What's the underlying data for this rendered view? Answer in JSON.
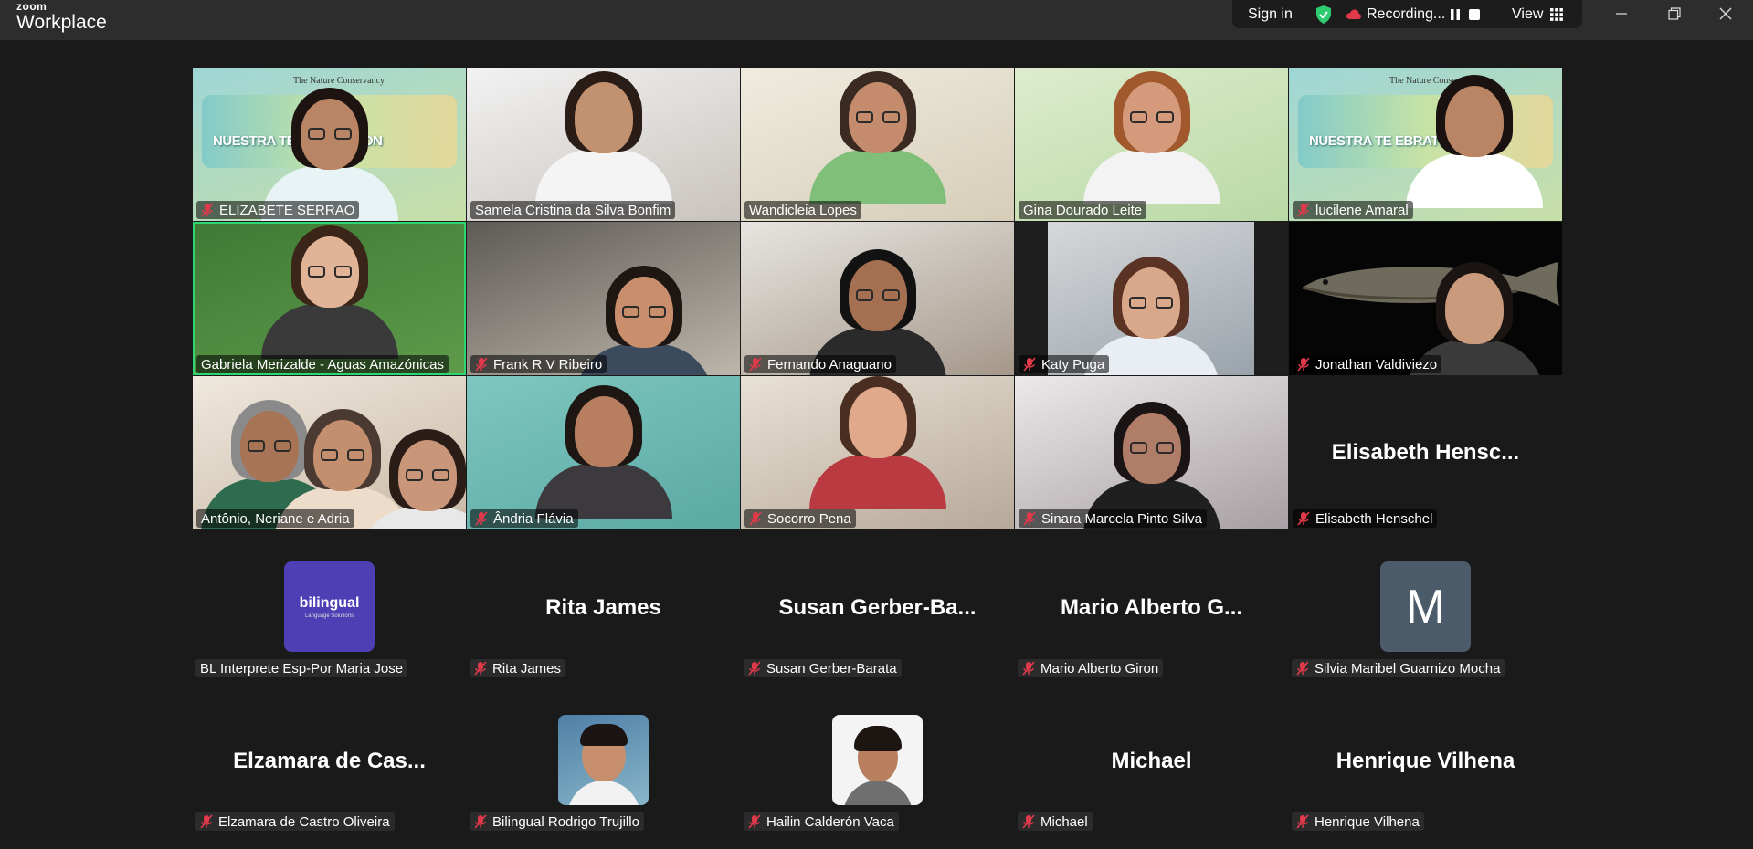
{
  "app": {
    "brand_top": "zoom",
    "brand_main": "Workplace"
  },
  "topbar": {
    "sign_in": "Sign in",
    "recording_label": "Recording...",
    "view_label": "View"
  },
  "participants": [
    {
      "name": "ELIZABETE SERRAO",
      "muted": true,
      "banner": "NUESTRA TE    ELEBRATION",
      "logo": "The Nature Conservancy"
    },
    {
      "name": "Samela Cristina da Silva Bonfim",
      "muted": false
    },
    {
      "name": "Wandicleia Lopes",
      "muted": false
    },
    {
      "name": "Gina Dourado Leite",
      "muted": false
    },
    {
      "name": "lucilene Amaral",
      "muted": true,
      "banner": "NUESTRA TE    EBRATION",
      "logo": "The Nature Conservancy"
    },
    {
      "name": "Gabriela Merizalde - Aguas Amazónicas",
      "muted": false,
      "active": true
    },
    {
      "name": "Frank R V Ribeiro",
      "muted": true
    },
    {
      "name": "Fernando Anaguano",
      "muted": true
    },
    {
      "name": "Katy Puga",
      "muted": true
    },
    {
      "name": "Jonathan Valdiviezo",
      "muted": true
    },
    {
      "name": "Antônio, Neriane e Adria",
      "muted": false
    },
    {
      "name": "Ândria Flávia",
      "muted": true
    },
    {
      "name": "Socorro Pena",
      "muted": true
    },
    {
      "name": "Sinara Marcela Pinto Silva",
      "muted": true
    },
    {
      "name": "Elisabeth Henschel",
      "display": "Elisabeth  Hensc...",
      "muted": true
    },
    {
      "name": "BL Interprete Esp-Por Maria Jose",
      "muted": false,
      "avatar_text": "bilingual",
      "avatar_sub": "Language Solutions"
    },
    {
      "name": "Rita James",
      "display": "Rita James",
      "muted": true
    },
    {
      "name": "Susan Gerber-Barata",
      "display": "Susan  Gerber-Ba...",
      "muted": true
    },
    {
      "name": "Mario Alberto Giron",
      "display": "Mario  Alberto  G...",
      "muted": true
    },
    {
      "name": "Silvia Maribel Guarnizo Mocha",
      "muted": true,
      "avatar_letter": "M"
    },
    {
      "name": "Elzamara de Castro Oliveira",
      "display": "Elzamara  de  Cas...",
      "muted": true
    },
    {
      "name": "Bilingual Rodrigo Trujillo",
      "muted": true
    },
    {
      "name": "Hailin Calderón Vaca",
      "muted": true
    },
    {
      "name": "Michael",
      "display": "Michael",
      "muted": true
    },
    {
      "name": "Henrique Vilhena",
      "display": "Henrique Vilhena",
      "muted": true
    }
  ],
  "colors": {
    "active_speaker": "#2ed573",
    "mute_icon": "#e0394a",
    "shield": "#2ecc71"
  }
}
